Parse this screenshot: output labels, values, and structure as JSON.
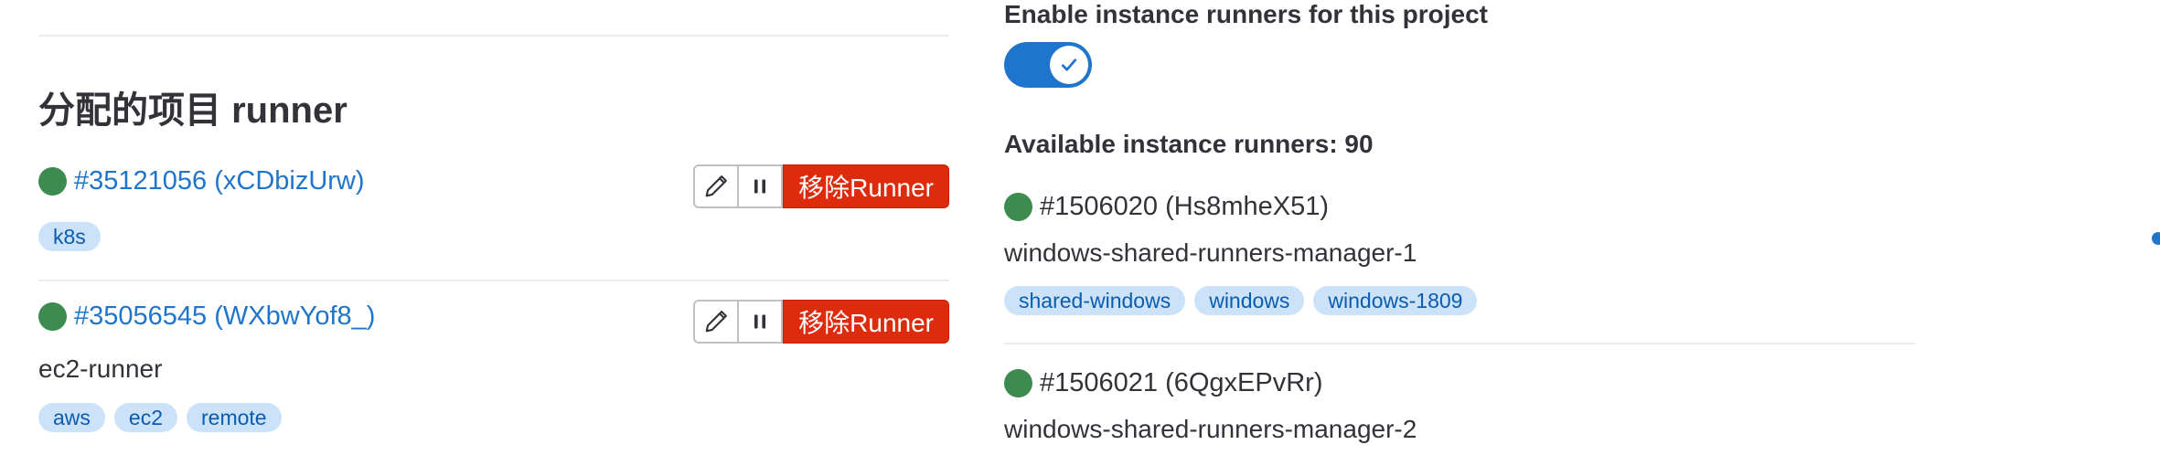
{
  "assigned": {
    "title": "分配的项目 runner",
    "remove_label": "移除Runner",
    "runners": [
      {
        "link": "#35121056 (xCDbizUrw)",
        "description": "",
        "tags": [
          "k8s"
        ]
      },
      {
        "link": "#35056545 (WXbwYof8_)",
        "description": "ec2-runner",
        "tags": [
          "aws",
          "ec2",
          "remote"
        ]
      }
    ]
  },
  "instance": {
    "toggle_label": "Enable instance runners for this project",
    "toggle_on": true,
    "available": "Available instance runners: 90",
    "runners": [
      {
        "id": "#1506020 (Hs8mheX51)",
        "description": "windows-shared-runners-manager-1",
        "tags": [
          "shared-windows",
          "windows",
          "windows-1809"
        ]
      },
      {
        "id": "#1506021 (6QgxEPvRr)",
        "description": "windows-shared-runners-manager-2",
        "tags": []
      }
    ]
  },
  "colors": {
    "status_online": "#3d8b50",
    "link": "#1f75cb",
    "danger": "#dd2b0e",
    "tag_bg": "#cbe2f9",
    "tag_text": "#0b5cad",
    "toggle_on": "#1f75cb"
  },
  "icons": [
    "pencil-icon",
    "pause-icon",
    "check-icon"
  ]
}
